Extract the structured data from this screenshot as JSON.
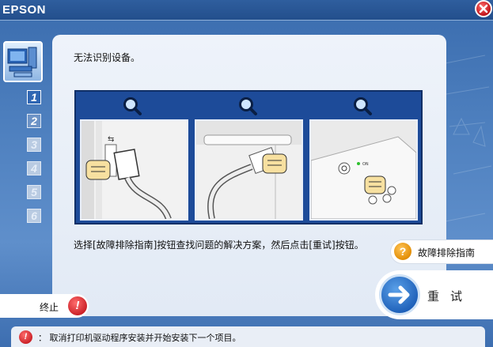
{
  "window": {
    "brand": "EPSON"
  },
  "steps": [
    "1",
    "2",
    "3",
    "4",
    "5",
    "6"
  ],
  "main": {
    "title": "无法识别设备。",
    "instruction": "选择[故障排除指南]按钮查找问题的解决方案，然后点击[重试]按钮。"
  },
  "buttons": {
    "guide_icon": "?",
    "guide_label": "故障排除指南",
    "retry_label": "重试",
    "quit_label": "终止",
    "quit_icon": "!"
  },
  "status": {
    "icon": "!",
    "text": "：  取消打印机驱动程序安装并开始安装下一个项目。"
  },
  "illustration": {
    "panels": [
      "usb-port-computer",
      "usb-port-printer",
      "printer-power-button"
    ],
    "power_label": "ON"
  },
  "colors": {
    "accent": "#2f66b3",
    "panel_bg": "#1d4b99",
    "warning": "#c81d24",
    "help": "#e08a00"
  }
}
